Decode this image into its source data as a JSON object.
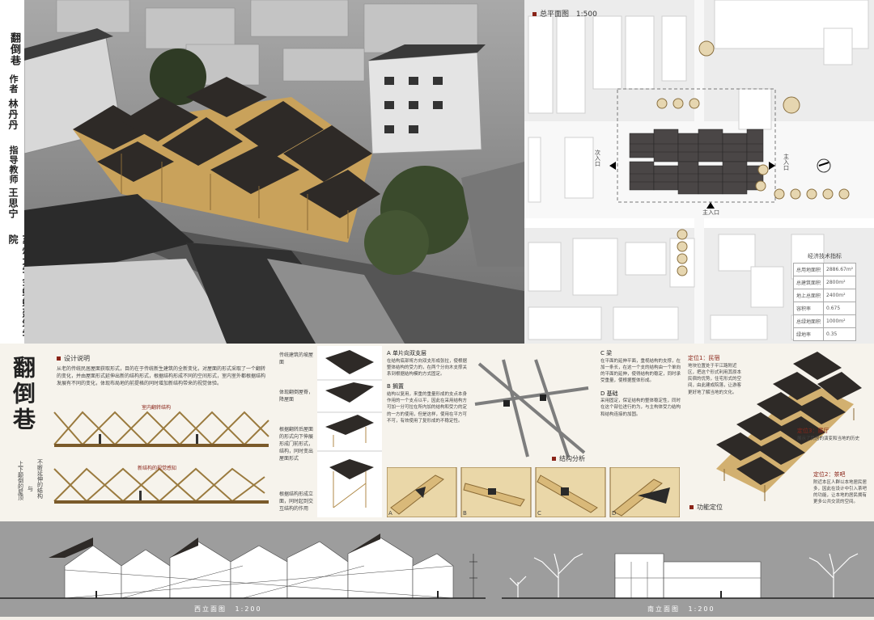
{
  "sidebar": {
    "title": "翻倒巷",
    "author_label": "作者",
    "author": "林丹丹",
    "advisor_label": "指导教师",
    "advisor": "王思宁",
    "school": "苏州大学金螳螂建筑学院"
  },
  "site_plan": {
    "title": "总平面图",
    "scale": "1:500",
    "entrance_main": "主入口",
    "entrance_side": "次入口",
    "entrance_main2": "主入口",
    "metrics_title": "经济技术指标",
    "metrics": [
      {
        "label": "总用地面积",
        "value": "2886.67m²"
      },
      {
        "label": "总建筑面积",
        "value": "2800m²"
      },
      {
        "label": "地上总面积",
        "value": "2400m²"
      },
      {
        "label": "容积率",
        "value": "0.675"
      },
      {
        "label": "总绿地面积",
        "value": "1000m²"
      },
      {
        "label": "绿地率",
        "value": "0.35"
      }
    ]
  },
  "middle": {
    "big_title": "翻倒巷",
    "design_heading": "设计说明",
    "design_text": "从老的传统民居屋面获取形式，目的在于传统新生建筑的全新变化，对屋面的形式采取了一个翻转的变化，并由屋面形式延伸出新的结构形式，根据结构形成不同的空间形式，室内室外都根据结构发展有不同的变化，体现布局地的前提格的同时增加新结构带来的视觉体验。",
    "diagram1_label": "室内翻转结构",
    "diagram2_label": "新结构的视觉感知",
    "side_caption_left": "上下颠倒的屋顶",
    "side_caption_mid": "与",
    "side_caption_right": "不断延伸的结构",
    "step_notes": [
      "传统建筑的坡屋面",
      "体现翻倒屋脊，降屋面",
      "根据翻转后屋面的形式向下伸展形成门前形式，结构，同时变出屋面形式",
      "根据结构形成立面，同时起到交互结构的作用"
    ],
    "structure_a_title": "A 单片向双支层",
    "structure_a_text": "在结构底部将方向双支形成张拉，使根据整体结构的受力的，在两个分向木支撑关系到根据结构模的方式固定。",
    "structure_b_title": "B 搁置",
    "structure_b_text": "结构以复用，来重的重量形成的支点本身作用的一个支点以平，因此在采用结构方可加一分可拉在所内加的结构和受力的定的一方的使用，但是这样，使用在平方可不可，有效使用了复形成的不稳定性。",
    "structure_c_title": "C 梁",
    "structure_c_text": "在平面的延伸平面，重视结构的支撑，在加一条长，在这一个支的结构由一个单向的平面的延伸，使得结构的稳定，同时承受重量，使根据整体形成。",
    "structure_d_title": "D 基础",
    "structure_d_text": "采用固定，保证结构的整体稳定性，同时在这个部位进行的为，与主构体受力结构和结构连接的加固。",
    "structure_heading": "结构分析",
    "detail_labels": [
      "A",
      "B",
      "C",
      "D"
    ],
    "function_heading": "功能定位",
    "function1_title": "定位1：民宿",
    "function1_text": "地块位置处于平江路附近区，把这个形式利用其原本民宿的优势，住宅形式的空间，由此建成院落，让游客更好地了解当地的文化。",
    "function2_title": "定位2：茶吧",
    "function2_text": "附近本区人群以本地居民居多，因此在设计中引入茶吧的功能，让本地的居民拥有更多公共交流的空间。",
    "function3_title": "定位3：展厅",
    "function3_text": "展示了民居的演变和当地的历史"
  },
  "elevations": {
    "west_title": "西立面图",
    "west_scale": "1:200",
    "south_title": "南立面图",
    "south_scale": "1:200"
  },
  "colors": {
    "accent": "#8a2418",
    "timber": "#c9a25b",
    "roof": "#2e2a27",
    "bottom_band": "#9d9d9d"
  }
}
